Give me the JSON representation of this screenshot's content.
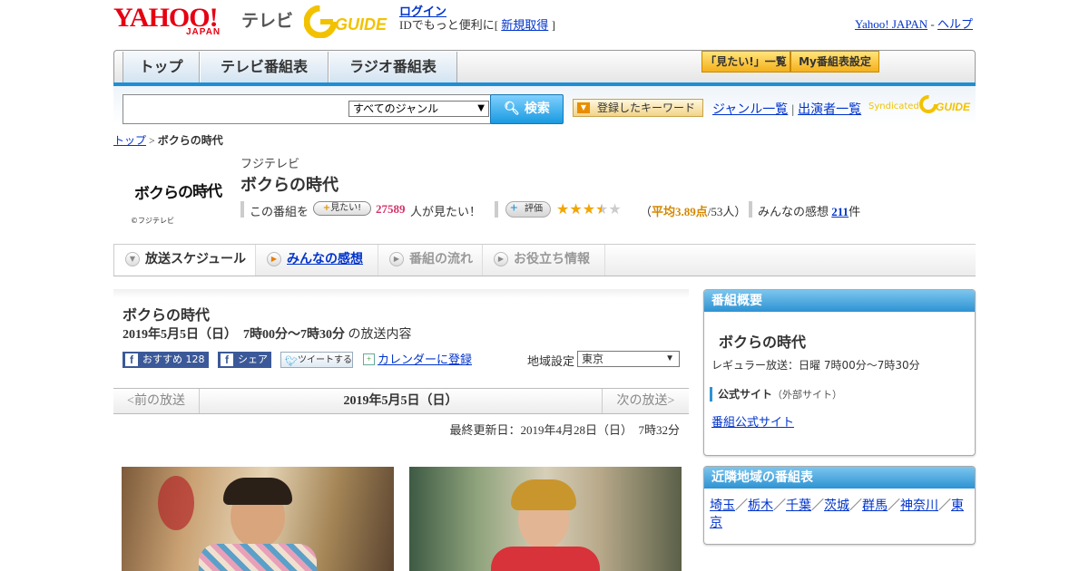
{
  "header": {
    "yahoo_logo": "YAHOO!",
    "yahoo_sub": "JAPAN",
    "tv_label": "テレビ",
    "gguide_logo": "GUIDE",
    "login_link": "ログイン",
    "id_text": "IDでもっと便利に[ ",
    "register_link": "新規取得",
    "id_suffix": " ]",
    "yahoo_japan_link": "Yahoo! JAPAN",
    "dash": " - ",
    "help_link": "ヘルプ"
  },
  "nav": {
    "tabs": [
      "トップ",
      "テレビ番組表",
      "ラジオ番組表"
    ],
    "mitai_list": "「見たい!」一覧",
    "my_bangumi": "My番組表設定"
  },
  "search": {
    "placeholder": "",
    "genre_selected": "すべてのジャンル",
    "button": "検索",
    "keyword_button": "登録したキーワード",
    "genre_list_link": "ジャンル一覧",
    "separator": "|",
    "performers_link": "出演者一覧",
    "syndicated": "Syndicated"
  },
  "breadcrumb": {
    "top": "トップ",
    "sep": " > ",
    "current": "ボクらの時代"
  },
  "program": {
    "logo_text": "ボクらの時代",
    "logo_copyright": "©フジテレビ",
    "station": "フジテレビ",
    "title": "ボクらの時代",
    "mitai_prefix": "この番組を",
    "mitai_button": "見たい!",
    "mitai_count": "27589",
    "mitai_suffix": "人が見たい！",
    "hyoka_button": "評価",
    "rating_value": 3.89,
    "rating_open": "（",
    "rating_avg_label": "平均3.89点",
    "rating_people": "/53人）",
    "kansou_label": "みんなの感想 ",
    "kansou_count": "211",
    "kansou_unit": "件"
  },
  "tabs": {
    "schedule": "放送スケジュール",
    "kansou": "みんなの感想",
    "nagare": "番組の流れ",
    "info": "お役立ち情報"
  },
  "main": {
    "title": "ボクらの時代",
    "date": "2019年5月5日（日）　7時00分～7時30分",
    "date_suffix": " の放送内容",
    "fb_recommend": "おすすめ 128",
    "fb_share": "シェア",
    "tweet": "ツイートする",
    "calendar": "カレンダーに登録",
    "region_label": "地域設定",
    "region_value": "東京",
    "prev": "<前の放送",
    "current_day": "2019年5月5日（日）",
    "next": "次の放送>",
    "updated": "最終更新日：2019年4月28日（日）　7時32分"
  },
  "sidebar": {
    "overview_head": "番組概要",
    "overview_title": "ボクらの時代",
    "regular": "レギュラー放送：日曜 7時00分～7時30分",
    "official_label": "公式サイト",
    "official_note": "（外部サイト）",
    "official_link": "番組公式サイト",
    "nearby_head": "近隣地域の番組表",
    "nearby": [
      "埼玉",
      "栃木",
      "千葉",
      "茨城",
      "群馬",
      "神奈川",
      "東京"
    ],
    "nearby_sep": "／"
  },
  "colors": {
    "accent_blue": "#1c8fd6",
    "link": "#0033cc",
    "yahoo_red": "#e60012",
    "mitai_pink": "#d6336c",
    "rating_orange": "#d48700"
  }
}
